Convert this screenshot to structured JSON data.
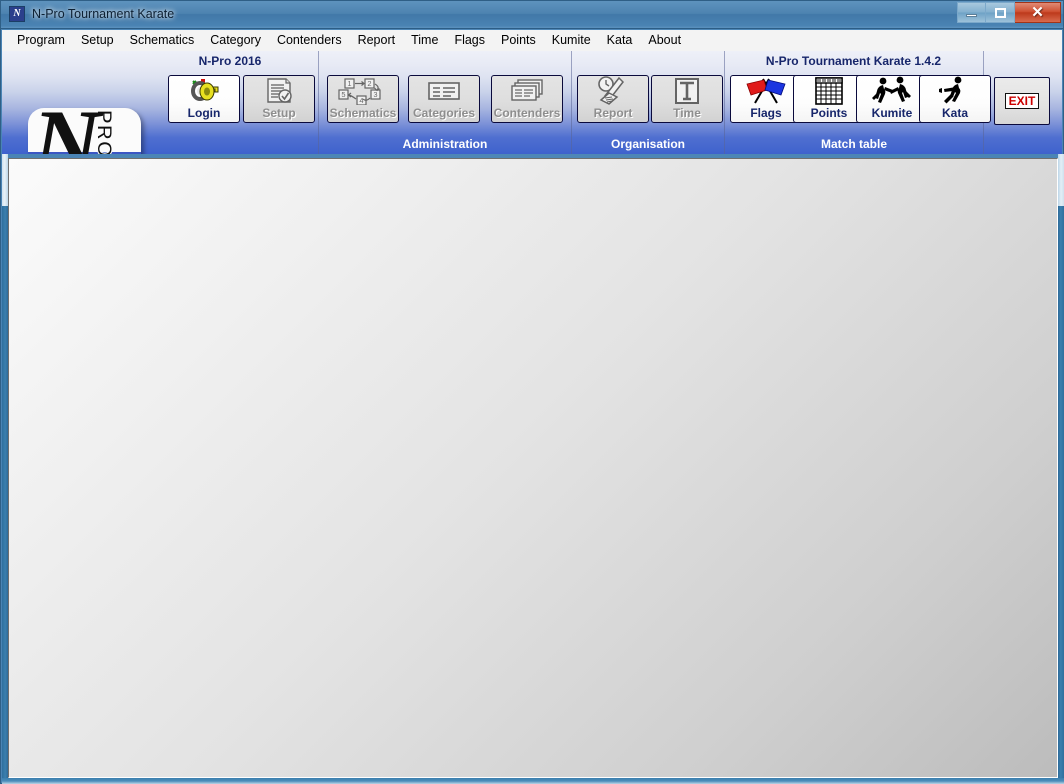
{
  "window": {
    "title": "N-Pro Tournament Karate",
    "app_icon": "N",
    "controls": {
      "minimize": "minimize-icon",
      "maximize": "maximize-icon",
      "close": "✕"
    }
  },
  "menubar": {
    "items": [
      {
        "label": "Program"
      },
      {
        "label": "Setup"
      },
      {
        "label": "Schematics"
      },
      {
        "label": "Category"
      },
      {
        "label": "Contenders"
      },
      {
        "label": "Report"
      },
      {
        "label": "Time"
      },
      {
        "label": "Flags"
      },
      {
        "label": "Points"
      },
      {
        "label": "Kumite"
      },
      {
        "label": "Kata"
      },
      {
        "label": "About"
      }
    ]
  },
  "toolbar": {
    "logo": {
      "letter": "N",
      "word": "PRO"
    },
    "groups": [
      {
        "id": "session",
        "title": "N-Pro 2016",
        "footer": "",
        "buttons": [
          {
            "label": "Login",
            "icon": "key-icon",
            "enabled": true
          },
          {
            "label": "Setup",
            "icon": "document-check-icon",
            "enabled": false
          }
        ]
      },
      {
        "id": "administration",
        "title": "",
        "footer": "Administration",
        "buttons": [
          {
            "label": "Schematics",
            "icon": "flowchart-icon",
            "enabled": false
          },
          {
            "label": "Categories",
            "icon": "card-list-icon",
            "enabled": false
          },
          {
            "label": "Contenders",
            "icon": "stacked-cards-icon",
            "enabled": false
          }
        ]
      },
      {
        "id": "organisation",
        "title": "",
        "footer": "Organisation",
        "buttons": [
          {
            "label": "Report",
            "icon": "clock-report-icon",
            "enabled": false
          },
          {
            "label": "Time",
            "icon": "timer-t-icon",
            "enabled": false
          }
        ]
      },
      {
        "id": "match-table",
        "title": "N-Pro Tournament Karate 1.4.2",
        "footer": "Match table",
        "buttons": [
          {
            "label": "Flags",
            "icon": "crossed-flags-icon",
            "enabled": true
          },
          {
            "label": "Points",
            "icon": "score-grid-icon",
            "enabled": true
          },
          {
            "label": "Kumite",
            "icon": "two-fighters-icon",
            "enabled": true
          },
          {
            "label": "Kata",
            "icon": "single-fighter-icon",
            "enabled": true
          }
        ]
      }
    ],
    "exit": {
      "label": "EXIT",
      "icon": "exit-icon"
    }
  },
  "colors": {
    "titlebar": "#4d83b0",
    "toolbar_bottom": "#3f62cd",
    "group_title": "#17266b",
    "exit_red": "#cc0000",
    "flag_red": "#e01b1b",
    "flag_blue": "#1b35e0"
  }
}
